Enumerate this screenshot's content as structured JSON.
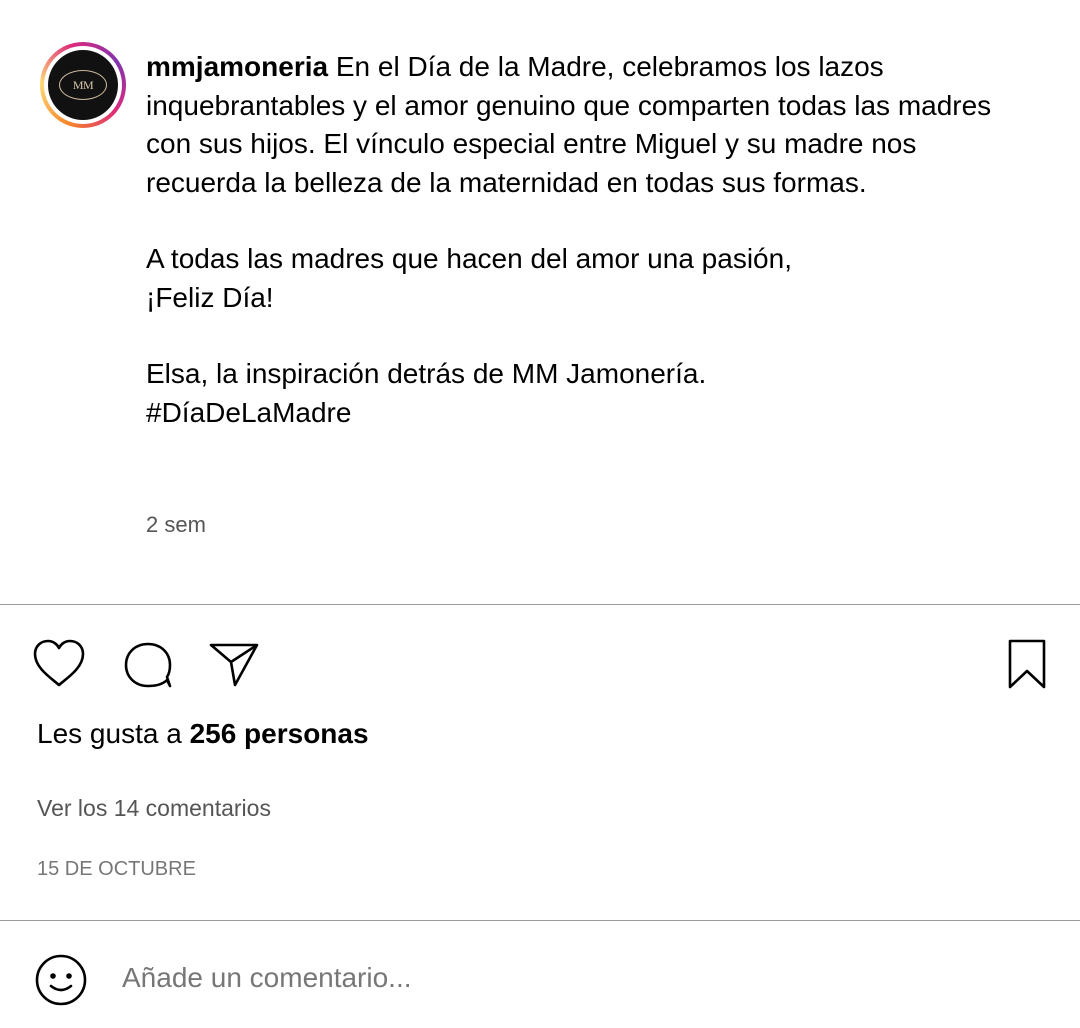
{
  "post": {
    "avatar_text": "MM",
    "username": "mmjamoneria",
    "caption_line1": "En el Día de la Madre, celebramos los lazos inquebrantables y el amor genuino que comparten todas las madres con sus hijos. El vínculo especial entre Miguel y su madre nos recuerda la belleza de la maternidad en todas sus formas.",
    "caption_line2a": "A todas las madres que hacen del amor una pasión,",
    "caption_line2b": "¡Feliz Día!",
    "caption_line3a": "Elsa, la inspiración detrás de MM Jamonería.",
    "caption_line3b": "#DíaDeLaMadre",
    "time_ago": "2 sem"
  },
  "actions": {
    "like_icon": "heart-icon",
    "comment_icon": "comment-bubble-icon",
    "share_icon": "paper-plane-icon",
    "save_icon": "bookmark-icon"
  },
  "likes": {
    "prefix": "Les gusta a",
    "count_text": "256 personas"
  },
  "comments": {
    "view_all": "Ver los 14 comentarios"
  },
  "date": "15 DE OCTUBRE",
  "comment_box": {
    "emoji_icon": "smiley-icon",
    "placeholder": "Añade un comentario..."
  },
  "colors": {
    "text_primary": "#000000",
    "text_secondary": "#555555",
    "divider": "#9a9a9a",
    "story_ring": "#dd2a7b"
  }
}
